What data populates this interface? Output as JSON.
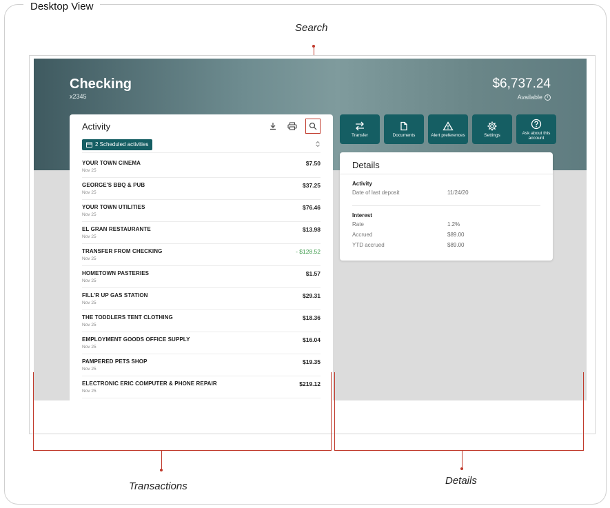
{
  "frame": {
    "title": "Desktop View"
  },
  "callouts": {
    "search": "Search",
    "transactions": "Transactions",
    "details": "Details"
  },
  "account": {
    "title": "Checking",
    "number": "x2345",
    "balance": "$6,737.24",
    "available_label": "Available"
  },
  "activity": {
    "title": "Activity",
    "scheduled_label": "2 Scheduled activities",
    "transactions": [
      {
        "name": "YOUR TOWN CINEMA",
        "date": "Nov 25",
        "amount": "$7.50",
        "credit": false
      },
      {
        "name": "GEORGE'S BBQ & PUB",
        "date": "Nov 25",
        "amount": "$37.25",
        "credit": false
      },
      {
        "name": "YOUR TOWN UTILITIES",
        "date": "Nov 25",
        "amount": "$76.46",
        "credit": false
      },
      {
        "name": "EL GRAN RESTAURANTE",
        "date": "Nov 25",
        "amount": "$13.98",
        "credit": false
      },
      {
        "name": "TRANSFER FROM CHECKING",
        "date": "Nov 25",
        "amount": "- $128.52",
        "credit": true
      },
      {
        "name": "HOMETOWN PASTERIES",
        "date": "Nov 25",
        "amount": "$1.57",
        "credit": false
      },
      {
        "name": "FILL'R UP GAS STATION",
        "date": "Nov 25",
        "amount": "$29.31",
        "credit": false
      },
      {
        "name": "THE TODDLERS TENT CLOTHING",
        "date": "Nov 25",
        "amount": "$18.36",
        "credit": false
      },
      {
        "name": "EMPLOYMENT GOODS OFFICE SUPPLY",
        "date": "Nov 25",
        "amount": "$16.04",
        "credit": false
      },
      {
        "name": "PAMPERED PETS SHOP",
        "date": "Nov 25",
        "amount": "$19.35",
        "credit": false
      },
      {
        "name": "ELECTRONIC ERIC COMPUTER & PHONE REPAIR",
        "date": "Nov 25",
        "amount": "$219.12",
        "credit": false
      }
    ]
  },
  "actions": [
    {
      "label": "Transfer",
      "icon": "transfer-icon"
    },
    {
      "label": "Documents",
      "icon": "document-icon"
    },
    {
      "label": "Alert preferences",
      "icon": "alert-icon"
    },
    {
      "label": "Settings",
      "icon": "gear-icon"
    },
    {
      "label": "Ask about this account",
      "icon": "help-icon"
    }
  ],
  "details": {
    "title": "Details",
    "activity": {
      "heading": "Activity",
      "last_deposit_label": "Date of last deposit",
      "last_deposit_value": "11/24/20"
    },
    "interest": {
      "heading": "Interest",
      "rate_label": "Rate",
      "rate_value": "1.2%",
      "accrued_label": "Accrued",
      "accrued_value": "$89.00",
      "ytd_label": "YTD accrued",
      "ytd_value": "$89.00"
    }
  },
  "colors": {
    "accent": "#155e63",
    "callout": "#c0392b",
    "credit": "#3c9a4a"
  }
}
